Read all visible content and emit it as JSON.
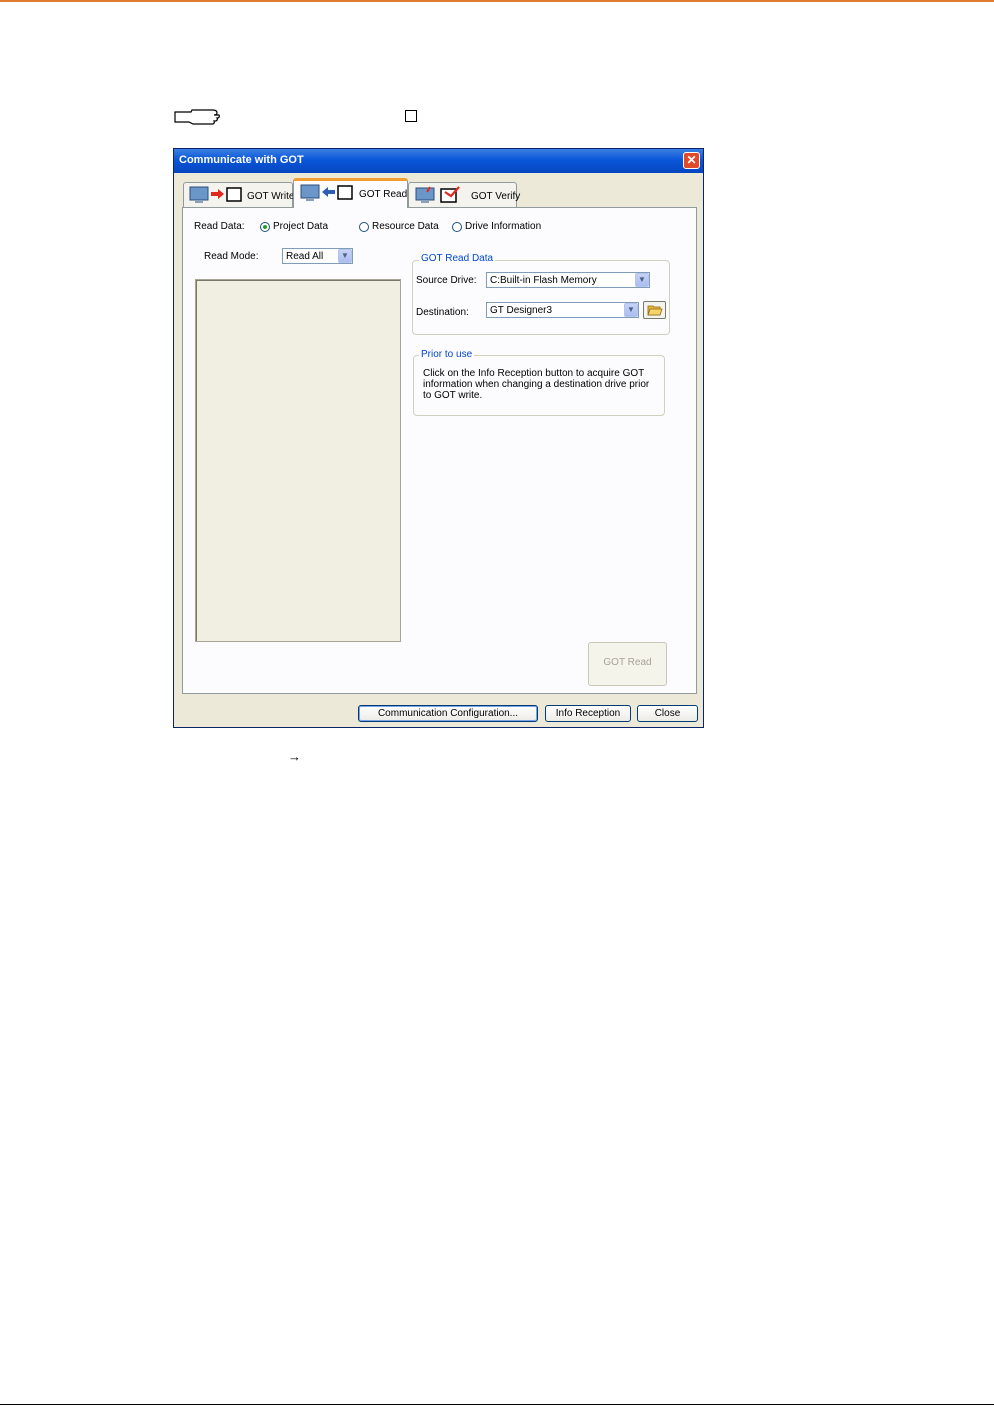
{
  "window": {
    "title": "Communicate with GOT",
    "close_glyph": "✕"
  },
  "tabs": [
    {
      "label": "GOT Write",
      "icon": "monitor-arrow-right-icon",
      "active": false
    },
    {
      "label": "GOT Read",
      "icon": "monitor-arrow-left-icon",
      "active": true
    },
    {
      "label": "GOT Verify",
      "icon": "monitor-check-icon",
      "active": false
    }
  ],
  "read_data": {
    "label": "Read Data:",
    "options": [
      {
        "label": "Project Data",
        "checked": true
      },
      {
        "label": "Resource Data",
        "checked": false
      },
      {
        "label": "Drive Information",
        "checked": false
      }
    ]
  },
  "read_mode": {
    "label": "Read Mode:",
    "value": "Read All"
  },
  "got_read_data": {
    "title": "GOT Read Data",
    "source_drive_label": "Source Drive:",
    "source_drive_value": "C:Built-in Flash Memory",
    "destination_label": "Destination:",
    "destination_value": "GT Designer3"
  },
  "prior_to_use": {
    "title": "Prior to use",
    "text": "Click on the Info Reception button to acquire GOT information when changing a destination drive prior to GOT write."
  },
  "buttons": {
    "got_read": "GOT Read",
    "communication_configuration": "Communication Configuration...",
    "info_reception": "Info Reception",
    "close": "Close"
  },
  "page": {
    "arrow_glyph": "→"
  },
  "colors": {
    "accent_rule": "#e07a2c",
    "titlebar": "#0a56d8",
    "active_tab_highlight": "#f0a030",
    "group_title": "#0046d5"
  }
}
